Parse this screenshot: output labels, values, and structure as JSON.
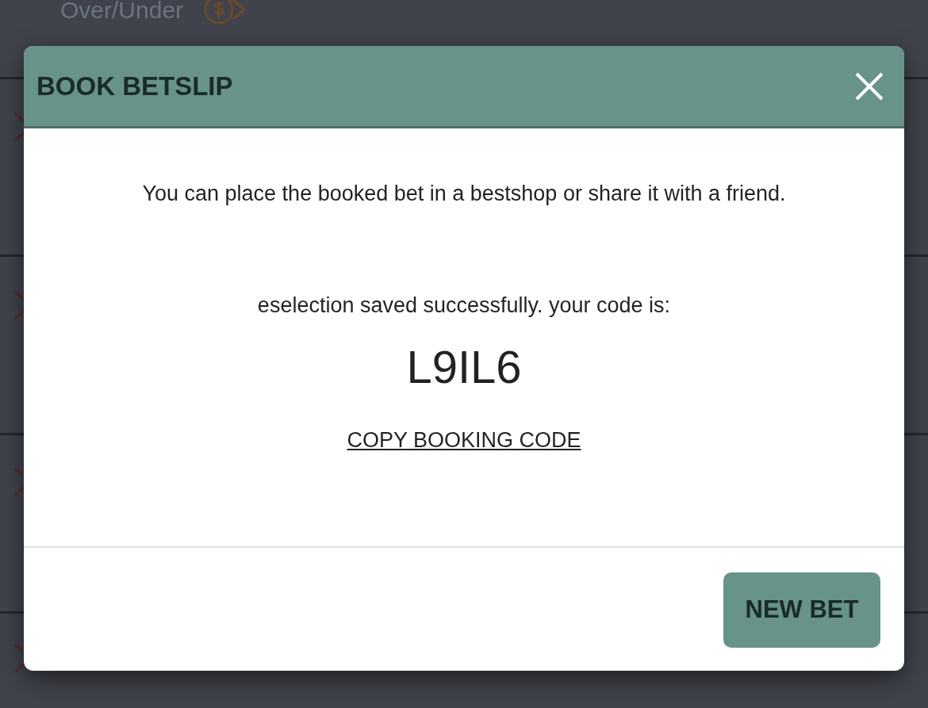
{
  "background": {
    "market": "Over/Under"
  },
  "modal": {
    "title": "BOOK BETSLIP",
    "message": "You can place the booked bet in a bestshop or share it with a friend.",
    "status": "eselection saved successfully. your code is:",
    "code": "L9IL6",
    "copy_link": "COPY BOOKING CODE",
    "button": "NEW BET"
  }
}
